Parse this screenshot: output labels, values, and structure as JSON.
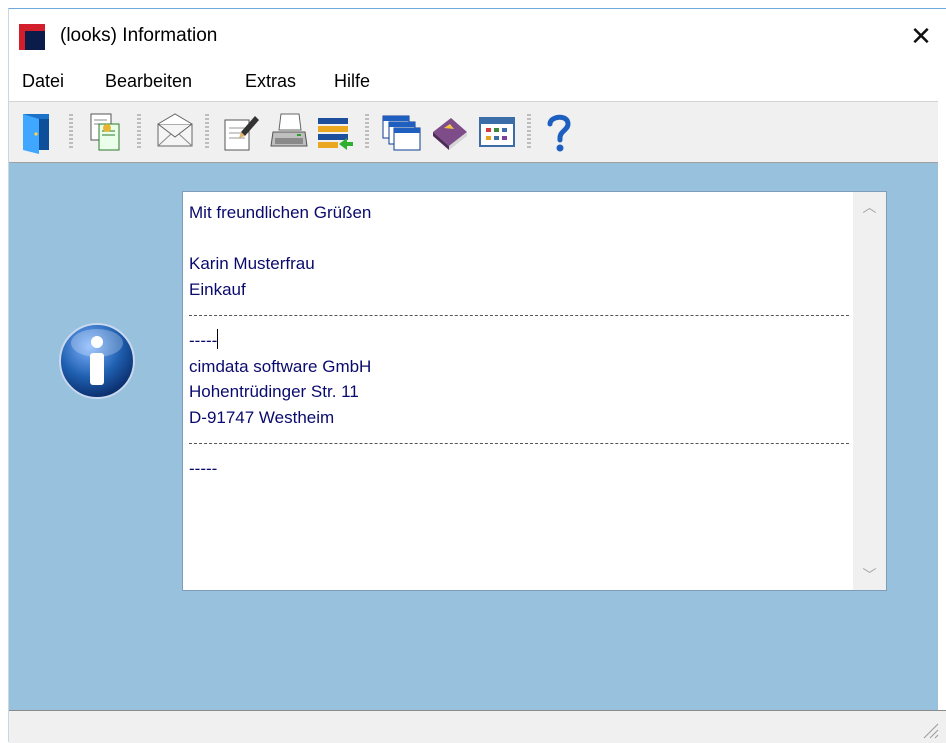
{
  "window": {
    "title": "(looks) Information",
    "close_glyph": "✕"
  },
  "menu": [
    {
      "label": "Datei"
    },
    {
      "label": "Bearbeiten"
    },
    {
      "label": "Extras"
    },
    {
      "label": "Hilfe"
    }
  ],
  "toolbar": {
    "buttons": [
      {
        "icon": "exit-door-icon"
      },
      {
        "icon": "copy-documents-icon"
      },
      {
        "icon": "envelope-icon"
      },
      {
        "icon": "edit-document-icon"
      },
      {
        "icon": "printer-icon"
      },
      {
        "icon": "import-list-icon"
      },
      {
        "icon": "windows-cascade-icon"
      },
      {
        "icon": "address-book-icon"
      },
      {
        "icon": "calendar-grid-icon"
      },
      {
        "icon": "help-question-icon"
      }
    ]
  },
  "memo": {
    "lines": [
      "Mit freundlichen Grüßen",
      "",
      "Karin Musterfrau",
      "Einkauf",
      "",
      "-----",
      "cimdata software GmbH",
      "Hohentrüdinger Str. 11",
      "D-91747 Westheim",
      "",
      "-----"
    ],
    "scroll_up_glyph": "︿",
    "scroll_down_glyph": "﹀"
  },
  "colors": {
    "client_bg": "#97c1dd",
    "text": "#0a0a6e",
    "info_blue": "#1f5fb0"
  }
}
